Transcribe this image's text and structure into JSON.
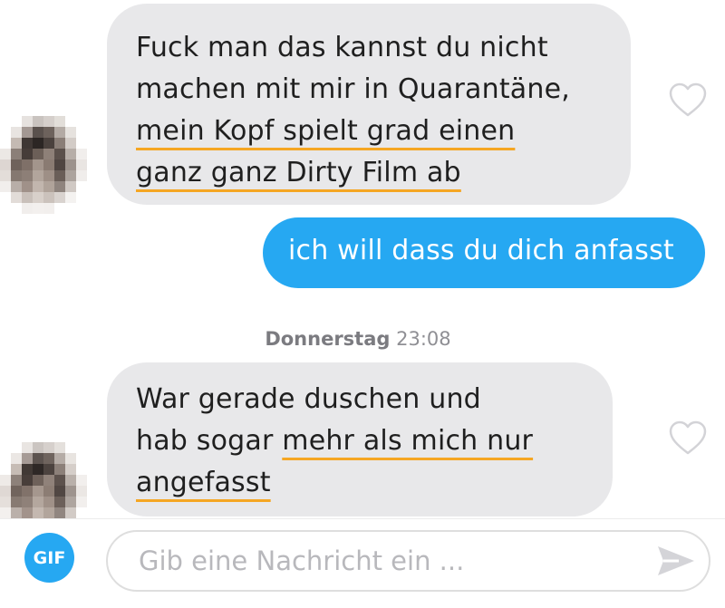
{
  "conversation": {
    "messages": [
      {
        "sender": "match",
        "lines": [
          {
            "parts": [
              {
                "text": "Fuck man das kannst du nicht",
                "highlight": false
              }
            ]
          },
          {
            "parts": [
              {
                "text": "machen mit mir in Quarantäne,",
                "highlight": false
              }
            ]
          },
          {
            "parts": [
              {
                "text": "mein Kopf spielt grad einen",
                "highlight": true
              }
            ]
          },
          {
            "parts": [
              {
                "text": "ganz ganz Dirty Film ab",
                "highlight": true
              }
            ]
          }
        ],
        "liked": false
      },
      {
        "sender": "me",
        "text": "ich will dass du dich anfasst"
      },
      {
        "sender": "match",
        "lines": [
          {
            "parts": [
              {
                "text": "War gerade duschen und",
                "highlight": false
              }
            ]
          },
          {
            "parts": [
              {
                "text": "hab sogar ",
                "highlight": false
              },
              {
                "text": "mehr als mich nur",
                "highlight": true
              }
            ]
          },
          {
            "parts": [
              {
                "text": "angefasst",
                "highlight": true
              }
            ]
          }
        ],
        "liked": false
      }
    ],
    "timestamp": {
      "day": "Donnerstag",
      "time": "23:08"
    }
  },
  "composer": {
    "gif_label": "GIF",
    "input_value": "",
    "placeholder": "Gib eine Nachricht ein ..."
  },
  "icons": {
    "like": "heart-outline-icon",
    "send": "paper-plane-icon"
  },
  "colors": {
    "accent_blue": "#26a8f2",
    "received_bubble": "#e8e8ea",
    "highlight_underline": "#f5a623",
    "timestamp_text": "#8f8f94"
  }
}
